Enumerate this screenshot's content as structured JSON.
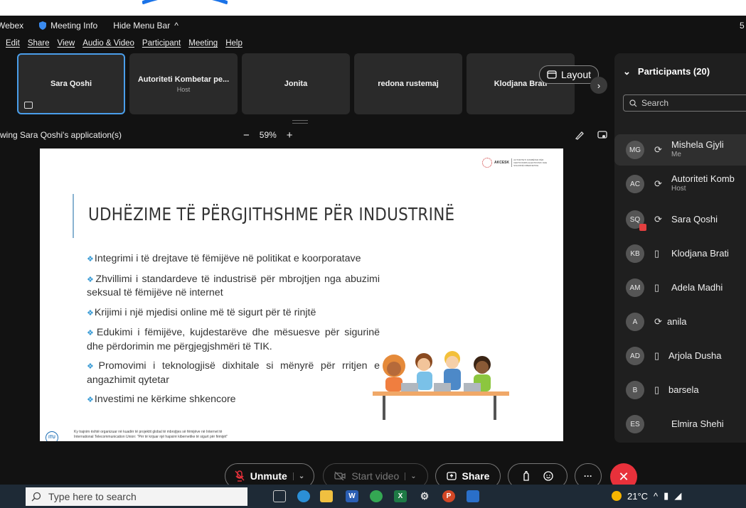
{
  "titlebar": {
    "app": "Webex",
    "meeting_info": "Meeting Info",
    "hide_menu": "Hide Menu Bar",
    "hide_menu_arrow": "^",
    "clock_fragment": "5"
  },
  "menubar": [
    "Edit",
    "Share",
    "View",
    "Audio & Video",
    "Participant",
    "Meeting",
    "Help"
  ],
  "video_strip": [
    {
      "name": "Sara Qoshi",
      "sub": "",
      "active": true
    },
    {
      "name": "Autoriteti Kombetar pe...",
      "sub": "Host",
      "active": false
    },
    {
      "name": "Jonita",
      "sub": "",
      "active": false
    },
    {
      "name": "redona rustemaj",
      "sub": "",
      "active": false
    },
    {
      "name": "Klodjana Brati",
      "sub": "",
      "active": false
    }
  ],
  "layout_button": "Layout",
  "share_bar": {
    "label": "wing Sara Qoshi's application(s)",
    "minus": "−",
    "zoom": "59%",
    "plus": "+"
  },
  "slide": {
    "logo_text": "AKCESK",
    "logo_sub": "AUTORITETI KOMBËTAR PËR CERTIFIKIMIN ELEKTRONIK DHE SIGURINË KIBERNETIKE",
    "title": "UDHËZIME TË PËRGJITHSHME PËR INDUSTRINË",
    "bullets": [
      "Integrimi i të drejtave të fëmijëve në politikat e koorporatave",
      "Zhvillimi i standardeve të industrisë për mbrojtjen nga abuzimi seksual të fëmijëve në internet",
      "Krijimi i një mjedisi online më të sigurt për të rinjtë",
      "Edukimi i fëmijëve, kujdestarëve dhe mësuesve për sigurinë dhe përdorimin me përgjegjshmëri të TIK.",
      "Promovimi i teknologjisë dixhitale si mënyrë për rritjen e angazhimit qytetar",
      "Investimi ne kërkime shkencore"
    ],
    "itu_logo": "ITU",
    "footer_line1": "Ky trajnim është organizuar në kuadër të projektit global të mbrojtjes së fëmijëve në Internet të",
    "footer_line2": "International Telecommunication Union: \"Për të krijuar një hapsirë kibernetike të sigurt për fëmijët\""
  },
  "participants": {
    "header": "Participants (20)",
    "search_placeholder": "Search",
    "list": [
      {
        "initials": "MG",
        "name": "Mishela Gjyli",
        "sub": "Me",
        "status": "audio-icon",
        "me": true
      },
      {
        "initials": "AC",
        "name": "Autoriteti Komb",
        "sub": "Host",
        "status": "audio-icon",
        "me": false
      },
      {
        "initials": "SQ",
        "name": "Sara Qoshi",
        "sub": "",
        "status": "audio-icon",
        "me": false
      },
      {
        "initials": "KB",
        "name": "Klodjana Brati",
        "sub": "",
        "status": "device-icon",
        "me": false
      },
      {
        "initials": "AM",
        "name": "Adela Madhi",
        "sub": "",
        "status": "device-icon",
        "me": false
      },
      {
        "initials": "A",
        "name": "anila",
        "sub": "",
        "status": "audio-icon",
        "me": false
      },
      {
        "initials": "AD",
        "name": "Arjola Dusha",
        "sub": "",
        "status": "device-icon",
        "me": false
      },
      {
        "initials": "B",
        "name": "barsela",
        "sub": "",
        "status": "device-icon",
        "me": false
      },
      {
        "initials": "ES",
        "name": "Elmira Shehi",
        "sub": "",
        "status": "",
        "me": false
      }
    ]
  },
  "controls": {
    "unmute": "Unmute",
    "start_video": "Start video",
    "share": "Share"
  },
  "taskbar": {
    "search_placeholder": "Type here to search",
    "temperature": "21°C"
  },
  "colors": {
    "accent_blue": "#4a9eea",
    "leave_red": "#e8313b",
    "bullet_blue": "#3a9bd5"
  }
}
